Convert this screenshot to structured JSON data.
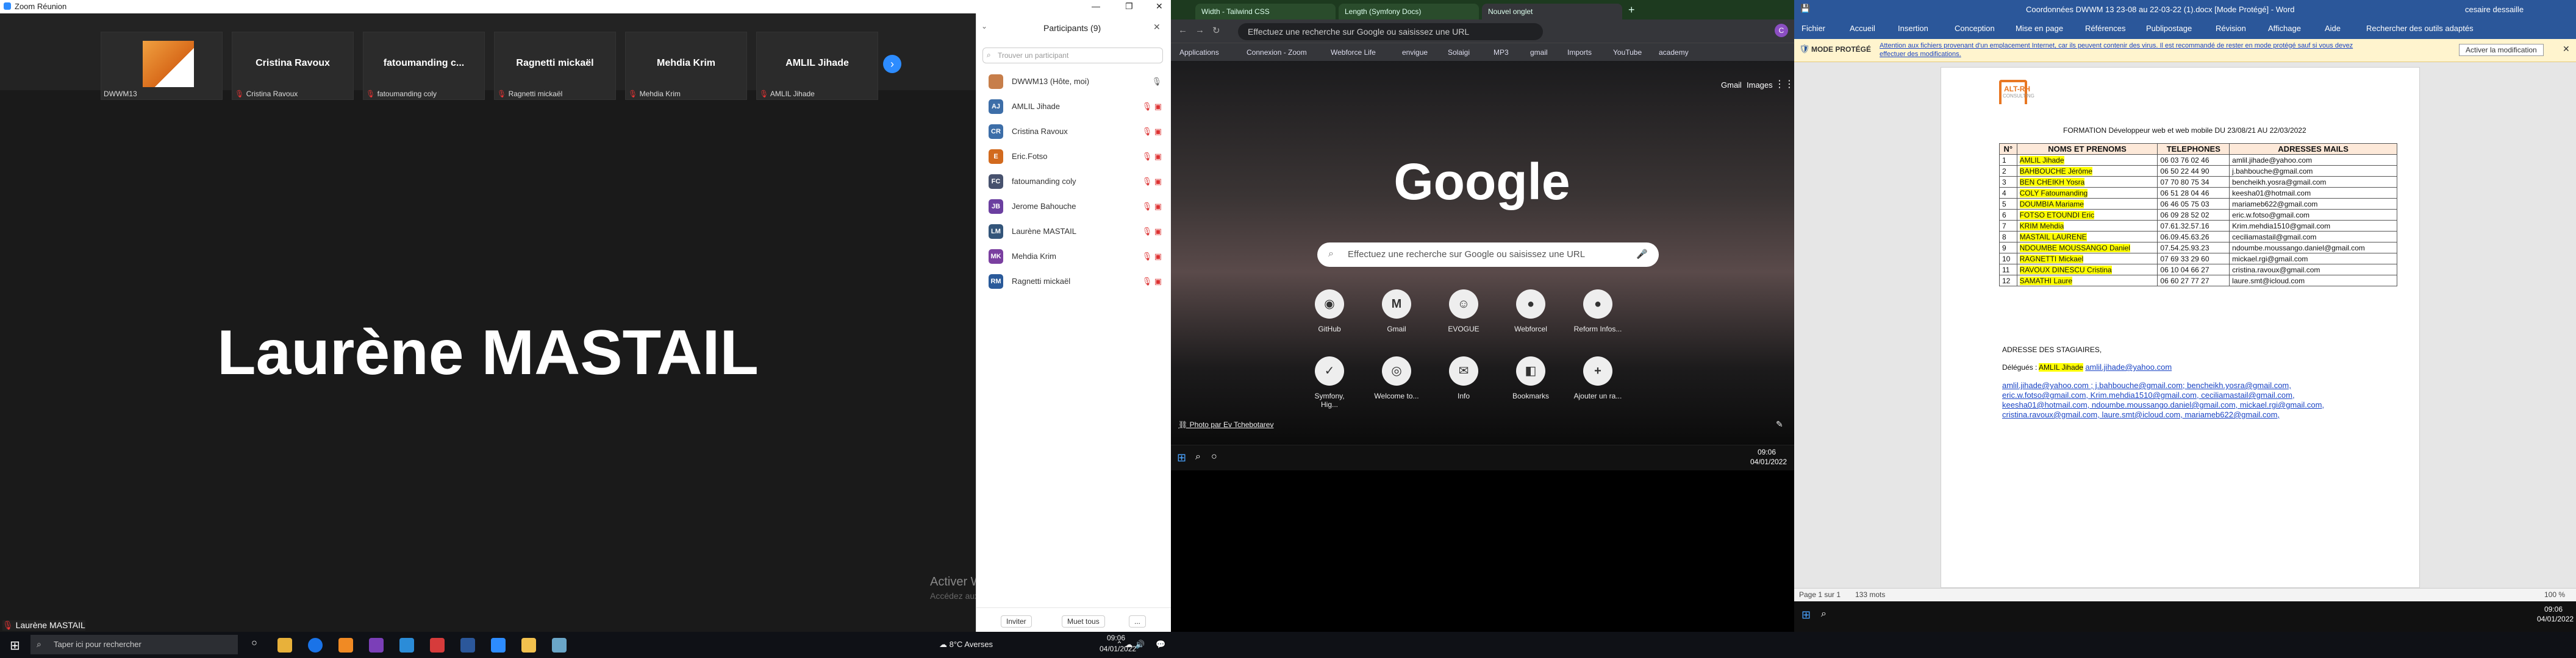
{
  "zoom": {
    "window_title": "Zoom Réunion",
    "window_controls": [
      "—",
      "❐",
      "✕"
    ],
    "gallery": [
      {
        "name": "DWWM13",
        "caption": "DWWM13",
        "has_image": true
      },
      {
        "name": "Cristina Ravoux",
        "caption": "Cristina Ravoux"
      },
      {
        "name": "fatoumanding c...",
        "caption": "fatoumanding coly"
      },
      {
        "name": "Ragnetti mickaël",
        "caption": "Ragnetti mickaël"
      },
      {
        "name": "Mehdia Krim",
        "caption": "Mehdia Krim"
      },
      {
        "name": "AMLIL Jihade",
        "caption": "AMLIL Jihade"
      }
    ],
    "speaker": "Laurène MASTAIL",
    "bottom_label": "Laurène MASTAIL",
    "watermark_title": "Activer Windows",
    "watermark_sub": "Accédez aux paramètres pour activer Windows.",
    "participants_panel": {
      "title": "Participants (9)",
      "search_placeholder": "Trouver un participant",
      "list": [
        {
          "initials": "",
          "name": "DWWM13 (Hôte, moi)",
          "color": "#c77e4a"
        },
        {
          "initials": "AJ",
          "name": "AMLIL Jihade",
          "color": "#3d6ea8"
        },
        {
          "initials": "CR",
          "name": "Cristina Ravoux",
          "color": "#3d6ea8"
        },
        {
          "initials": "E",
          "name": "Eric.Fotso",
          "color": "#d26a1e"
        },
        {
          "initials": "FC",
          "name": "fatoumanding coly",
          "color": "#47526e"
        },
        {
          "initials": "JB",
          "name": "Jerome Bahouche",
          "color": "#6b3fa0"
        },
        {
          "initials": "LM",
          "name": "Laurène MASTAIL",
          "color": "#33557a"
        },
        {
          "initials": "MK",
          "name": "Mehdia Krim",
          "color": "#7a3fa0"
        },
        {
          "initials": "RM",
          "name": "Ragnetti mickaël",
          "color": "#2a5a9a"
        }
      ],
      "invite_label": "Inviter",
      "mute_all_label": "Muet tous",
      "more_label": "..."
    }
  },
  "chrome": {
    "tabs": [
      "Width - Tailwind CSS",
      "Length (Symfony Docs)",
      "Nouvel onglet"
    ],
    "new_tab": "+",
    "url_placeholder": "Effectuez une recherche sur Google ou saisissez une URL",
    "bookmarks": [
      "Applications",
      "Connexion - Zoom",
      "Webforce Life",
      "envigue",
      "Solaigi",
      "MP3",
      "gmail",
      "Imports",
      "YouTube",
      "academy"
    ],
    "top_links": [
      "Gmail",
      "Images"
    ],
    "avatar": "C",
    "logo": "Google",
    "search_placeholder": "Effectuez une recherche sur Google ou saisissez une URL",
    "shortcuts": [
      {
        "label": "GitHub",
        "glyph": "◉"
      },
      {
        "label": "Gmail",
        "glyph": "M"
      },
      {
        "label": "EVOGUE",
        "glyph": "☺"
      },
      {
        "label": "Webforcel",
        "glyph": "●"
      },
      {
        "label": "Reform Infos...",
        "glyph": "●"
      },
      {
        "label": "Symfony, Hig...",
        "glyph": "✓"
      },
      {
        "label": "Welcome to...",
        "glyph": "◎"
      },
      {
        "label": "Info",
        "glyph": "✉"
      },
      {
        "label": "Bookmarks",
        "glyph": "◧"
      },
      {
        "label": "Ajouter un ra...",
        "glyph": "+"
      }
    ],
    "photo_credit": "Photo par Ev Tchebotarev",
    "taskbar_time": "09:06",
    "taskbar_date": "04/01/2022"
  },
  "word": {
    "window_title": "Coordonnées DWWM 13 23-08 au 22-03-22 (1).docx [Mode Protégé] - Word",
    "user": "cesaire dessaille",
    "ribbon_tabs": [
      "Fichier",
      "Accueil",
      "Insertion",
      "Conception",
      "Mise en page",
      "Références",
      "Publipostage",
      "Révision",
      "Affichage",
      "Aide"
    ],
    "search_ribbon": "Rechercher des outils adaptés",
    "protected_label": "MODE PROTÉGÉ",
    "protected_text": "Attention aux fichiers provenant d'un emplacement Internet, car ils peuvent contenir des virus. Il est recommandé de rester en mode protégé sauf si vous devez effectuer des modifications.",
    "enable_editing": "Activer la modification",
    "logo_text": "ALT-RH",
    "logo_sub": "CONSULTING",
    "doc_title": "FORMATION Développeur web et web mobile DU 23/08/21  AU 22/03/2022",
    "table_headers": [
      "N°",
      "NOMS ET PRENOMS",
      "TELEPHONES",
      "ADRESSES MAILS"
    ],
    "rows": [
      [
        "1",
        "AMLIL Jihade",
        "06 03 76 02 46",
        "amlil.jihade@yahoo.com"
      ],
      [
        "2",
        "BAHBOUCHE Jérôme",
        "06 50 22 44 90",
        "j.bahbouche@gmail.com"
      ],
      [
        "3",
        "BEN CHEIKH Yosra",
        "07 70 80 75 34",
        "bencheikh.yosra@gmail.com"
      ],
      [
        "4",
        "COLY Fatoumanding",
        "06 51 28 04 46",
        "keesha01@hotmail.com"
      ],
      [
        "5",
        "DOUMBIA Mariame",
        "06 46 05 75 03",
        "mariameb622@gmail.com"
      ],
      [
        "6",
        "FOTSO ETOUNDI Eric",
        "06 09 28 52 02",
        "eric.w.fotso@gmail.com"
      ],
      [
        "7",
        "KRIM Mehdia",
        "07.61.32.57.16",
        "Krim.mehdia1510@gmail.com"
      ],
      [
        "8",
        "MASTAIL LAURENE",
        "06.09.45.63.26",
        "ceciliamastail@gmail.com"
      ],
      [
        "9",
        "NDOUMBE MOUSSANGO Daniel",
        "07.54.25.93.23",
        "ndoumbe.moussango.daniel@gmail.com"
      ],
      [
        "10",
        "RAGNETTI Mickael",
        "07 69 33 29 60",
        "mickael.rgi@gmail.com"
      ],
      [
        "11",
        "RAVOUX DINESCU Cristina",
        "06 10 04 66 27",
        "cristina.ravoux@gmail.com"
      ],
      [
        "12",
        "SAMATHI Laure",
        "06 60 27 77 27",
        "laure.smt@icloud.com"
      ]
    ],
    "delegates_heading": "ADRESSE DES STAGIAIRES,",
    "delegates_label": "Délégués :",
    "delegates_name": "AMLIL Jihade",
    "delegates_mail": "amlil.jihade@yahoo.com",
    "mail_lines": [
      "amlil.jihade@yahoo.com ; j.bahbouche@gmail.com;  bencheikh.yosra@gmail.com,",
      "eric.w.fotso@gmail.com, Krim.mehdia1510@gmail.com, ceciliamastail@gmail.com,",
      "keesha01@hotmail.com, ndoumbe.moussango.daniel@gmail.com, mickael.rgi@gmail.com,",
      "cristina.ravoux@gmail.com, laure.smt@icloud.com, mariameb622@gmail.com,"
    ],
    "status_page": "Page 1 sur 1",
    "status_words": "133 mots",
    "zoom_level": "100 %",
    "taskbar_time": "09:06",
    "taskbar_date": "04/01/2022"
  },
  "taskbar": {
    "search_placeholder": "Taper ici pour rechercher",
    "weather": "8°C  Averses",
    "time": "09:06",
    "date": "04/01/2022"
  }
}
